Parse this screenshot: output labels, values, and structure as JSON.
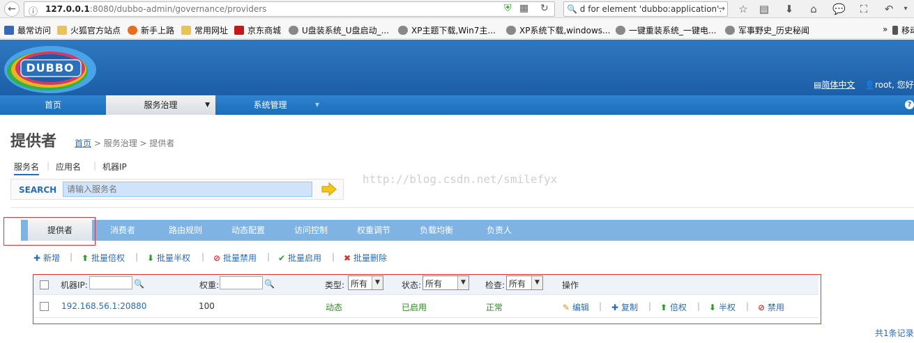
{
  "browser": {
    "url_host": "127.0.0.1",
    "url_rest": ":8080/dubbo-admin/governance/providers",
    "search_text": "d for element 'dubbo:application'.",
    "bookmarks": [
      "最常访问",
      "火狐官方站点",
      "新手上路",
      "常用网址",
      "京东商城",
      "U盘装系统_U盘启动_...",
      "XP主题下载,Win7主...",
      "XP系统下载,windows...",
      "一键重装系统_一键电...",
      "军事野史_历史秘闻"
    ],
    "bookmarks_more": "»",
    "bookmarks_mobile": "移动"
  },
  "header": {
    "logo_text": "DUBBO",
    "lang_link": "简体中文",
    "user_greeting": "root, 您好"
  },
  "nav": {
    "home": "首页",
    "governance": "服务治理",
    "governance_arrow": "▼",
    "system": "系统管理",
    "system_arrow": "▼",
    "help": "?"
  },
  "page": {
    "title": "提供者",
    "crumb_home": "首页",
    "crumb_rest": " > 服务治理 > 提供者",
    "watermark": "http://blog.csdn.net/smilefyx"
  },
  "search_tabs": [
    "服务名",
    "应用名",
    "机器IP"
  ],
  "search": {
    "label": "SEARCH",
    "placeholder": "请输入服务名"
  },
  "tabs": [
    "提供者",
    "消费者",
    "路由规则",
    "动态配置",
    "访问控制",
    "权重调节",
    "负载均衡",
    "负责人"
  ],
  "actions": {
    "add": "新增",
    "double": "批量倍权",
    "half": "批量半权",
    "disable": "批量禁用",
    "enable": "批量启用",
    "delete": "批量删除"
  },
  "table": {
    "col_ip": "机器IP:",
    "col_weight": "权重:",
    "col_type": "类型:",
    "col_status": "状态:",
    "col_check": "检查:",
    "col_ops": "操作",
    "filter_type": "所有",
    "filter_status": "所有",
    "filter_check": "所有",
    "rows": [
      {
        "address": "192.168.56.1:20880",
        "weight": "100",
        "type": "动态",
        "status": "已启用",
        "check": "正常",
        "ops": {
          "edit": "编辑",
          "copy": "复制",
          "double": "倍权",
          "half": "半权",
          "disable": "禁用"
        }
      }
    ],
    "total": "共1条记录"
  },
  "colors": {
    "header_blue": "#1c5ea8",
    "tab_blue": "#7fb3e3",
    "link_blue": "#2a6cb3",
    "status_green": "#2a8a1a",
    "highlight_red": "#e03030"
  }
}
